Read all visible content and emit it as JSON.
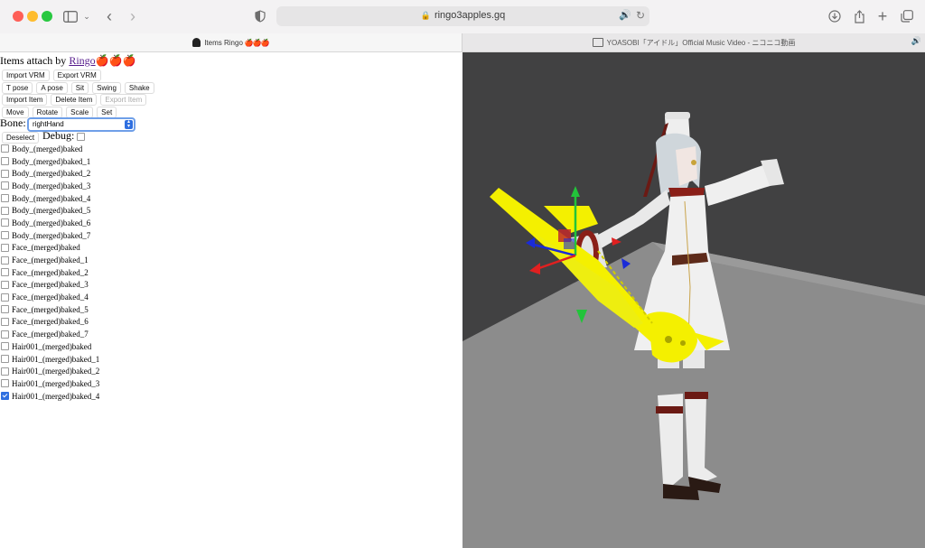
{
  "browser": {
    "url": "ringo3apples.gq",
    "icons": [
      "sidebar-icon",
      "chevron-down-icon",
      "back-icon",
      "forward-icon",
      "shield-icon",
      "lock-icon",
      "speaker-icon",
      "reload-icon",
      "download-icon",
      "share-icon",
      "new-tab-icon",
      "tabs-overview-icon"
    ],
    "tabs": [
      {
        "title": "Items Ringo",
        "apples": "🍎🍎🍎"
      },
      {
        "title": "YOASOBI「アイドル」Official Music Video - ニコニコ動画"
      }
    ]
  },
  "page": {
    "title_prefix": "Items attach by ",
    "title_link": "Ringo",
    "title_apples": "🍎🍎🍎",
    "buttons": {
      "import_vrm": "Import VRM",
      "export_vrm": "Export VRM",
      "t_pose": "T pose",
      "a_pose": "A pose",
      "sit": "Sit",
      "swing": "Swing",
      "shake": "Shake",
      "import_item": "Import Item",
      "delete_item": "Delete Item",
      "export_item": "Export Item",
      "move": "Move",
      "rotate": "Rotate",
      "scale": "Scale",
      "set": "Set",
      "deselect": "Deselect"
    },
    "bone_label": "Bone:",
    "bone_value": "rightHand",
    "debug_label": "Debug:",
    "items": [
      {
        "label": "Body_(merged)baked",
        "checked": false
      },
      {
        "label": "Body_(merged)baked_1",
        "checked": false
      },
      {
        "label": "Body_(merged)baked_2",
        "checked": false
      },
      {
        "label": "Body_(merged)baked_3",
        "checked": false
      },
      {
        "label": "Body_(merged)baked_4",
        "checked": false
      },
      {
        "label": "Body_(merged)baked_5",
        "checked": false
      },
      {
        "label": "Body_(merged)baked_6",
        "checked": false
      },
      {
        "label": "Body_(merged)baked_7",
        "checked": false
      },
      {
        "label": "Face_(merged)baked",
        "checked": false
      },
      {
        "label": "Face_(merged)baked_1",
        "checked": false
      },
      {
        "label": "Face_(merged)baked_2",
        "checked": false
      },
      {
        "label": "Face_(merged)baked_3",
        "checked": false
      },
      {
        "label": "Face_(merged)baked_4",
        "checked": false
      },
      {
        "label": "Face_(merged)baked_5",
        "checked": false
      },
      {
        "label": "Face_(merged)baked_6",
        "checked": false
      },
      {
        "label": "Face_(merged)baked_7",
        "checked": false
      },
      {
        "label": "Hair001_(merged)baked",
        "checked": false
      },
      {
        "label": "Hair001_(merged)baked_1",
        "checked": false
      },
      {
        "label": "Hair001_(merged)baked_2",
        "checked": false
      },
      {
        "label": "Hair001_(merged)baked_3",
        "checked": false
      },
      {
        "label": "Hair001_(merged)baked_4",
        "checked": true
      }
    ]
  },
  "colors": {
    "gizmo_x": "#e02020",
    "gizmo_y": "#22c43a",
    "gizmo_z": "#1a2bd8",
    "item_yellow": "#f4f000",
    "floor": "#8c8c8c",
    "background": "#414142"
  }
}
